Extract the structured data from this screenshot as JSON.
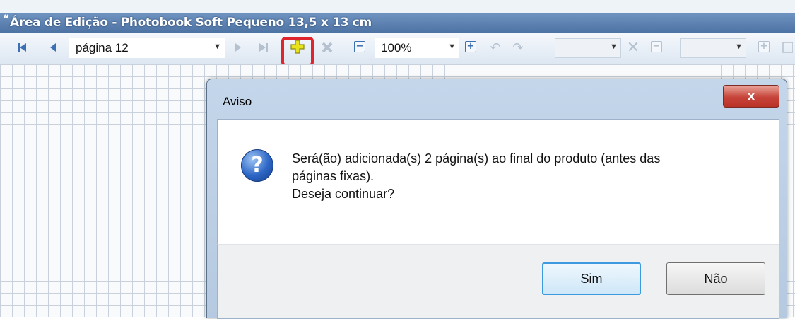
{
  "window": {
    "title": "Área de Edição - Photobook Soft Pequeno 13,5 x 13 cm"
  },
  "toolbar": {
    "page_select": "página 12",
    "zoom_select": "100%",
    "empty_select_1": "",
    "empty_select_2": ""
  },
  "dialog": {
    "title": "Aviso",
    "close_label": "x",
    "message_lines": [
      "Será(ão) adicionada(s) 2 página(s) ao final do produto (antes das",
      "páginas fixas).",
      "Deseja continuar?"
    ],
    "yes_label": "Sim",
    "no_label": "Não"
  },
  "colors": {
    "title_bar": "#4c72a3",
    "highlight": "#e0242c",
    "add_page_icon": "#e8e21a"
  }
}
